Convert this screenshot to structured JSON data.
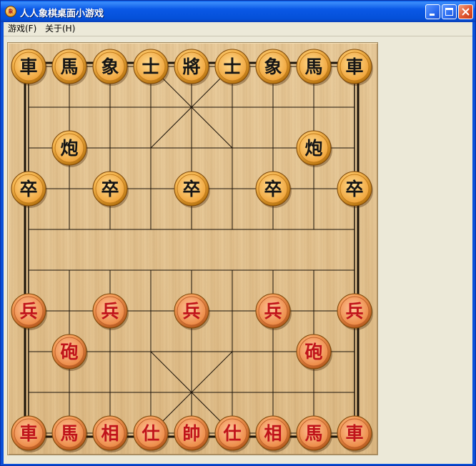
{
  "window": {
    "title": "人人象棋桌面小游戏",
    "app_icon_text": "象",
    "buttons": [
      "minimize-icon",
      "maximize-icon",
      "close-icon"
    ]
  },
  "menu": [
    {
      "label": "游戏(F)"
    },
    {
      "label": "关于(H)"
    }
  ],
  "board": {
    "files": 9,
    "ranks": 10,
    "colors": {
      "line": "#1a1208",
      "black_text": "#151515",
      "red_text": "#c0131a",
      "black_piece_face": "#f6b650",
      "red_piece_face": "#f39a55"
    },
    "pieces": [
      {
        "side": "black",
        "char": "車",
        "file": 0,
        "rank": 0
      },
      {
        "side": "black",
        "char": "馬",
        "file": 1,
        "rank": 0
      },
      {
        "side": "black",
        "char": "象",
        "file": 2,
        "rank": 0
      },
      {
        "side": "black",
        "char": "士",
        "file": 3,
        "rank": 0
      },
      {
        "side": "black",
        "char": "將",
        "file": 4,
        "rank": 0
      },
      {
        "side": "black",
        "char": "士",
        "file": 5,
        "rank": 0
      },
      {
        "side": "black",
        "char": "象",
        "file": 6,
        "rank": 0
      },
      {
        "side": "black",
        "char": "馬",
        "file": 7,
        "rank": 0
      },
      {
        "side": "black",
        "char": "車",
        "file": 8,
        "rank": 0
      },
      {
        "side": "black",
        "char": "炮",
        "file": 1,
        "rank": 2
      },
      {
        "side": "black",
        "char": "炮",
        "file": 7,
        "rank": 2
      },
      {
        "side": "black",
        "char": "卒",
        "file": 0,
        "rank": 3
      },
      {
        "side": "black",
        "char": "卒",
        "file": 2,
        "rank": 3
      },
      {
        "side": "black",
        "char": "卒",
        "file": 4,
        "rank": 3
      },
      {
        "side": "black",
        "char": "卒",
        "file": 6,
        "rank": 3
      },
      {
        "side": "black",
        "char": "卒",
        "file": 8,
        "rank": 3
      },
      {
        "side": "red",
        "char": "兵",
        "file": 0,
        "rank": 6
      },
      {
        "side": "red",
        "char": "兵",
        "file": 2,
        "rank": 6
      },
      {
        "side": "red",
        "char": "兵",
        "file": 4,
        "rank": 6
      },
      {
        "side": "red",
        "char": "兵",
        "file": 6,
        "rank": 6
      },
      {
        "side": "red",
        "char": "兵",
        "file": 8,
        "rank": 6
      },
      {
        "side": "red",
        "char": "砲",
        "file": 1,
        "rank": 7
      },
      {
        "side": "red",
        "char": "砲",
        "file": 7,
        "rank": 7
      },
      {
        "side": "red",
        "char": "車",
        "file": 0,
        "rank": 9
      },
      {
        "side": "red",
        "char": "馬",
        "file": 1,
        "rank": 9
      },
      {
        "side": "red",
        "char": "相",
        "file": 2,
        "rank": 9
      },
      {
        "side": "red",
        "char": "仕",
        "file": 3,
        "rank": 9
      },
      {
        "side": "red",
        "char": "帥",
        "file": 4,
        "rank": 9
      },
      {
        "side": "red",
        "char": "仕",
        "file": 5,
        "rank": 9
      },
      {
        "side": "red",
        "char": "相",
        "file": 6,
        "rank": 9
      },
      {
        "side": "red",
        "char": "馬",
        "file": 7,
        "rank": 9
      },
      {
        "side": "red",
        "char": "車",
        "file": 8,
        "rank": 9
      }
    ]
  }
}
